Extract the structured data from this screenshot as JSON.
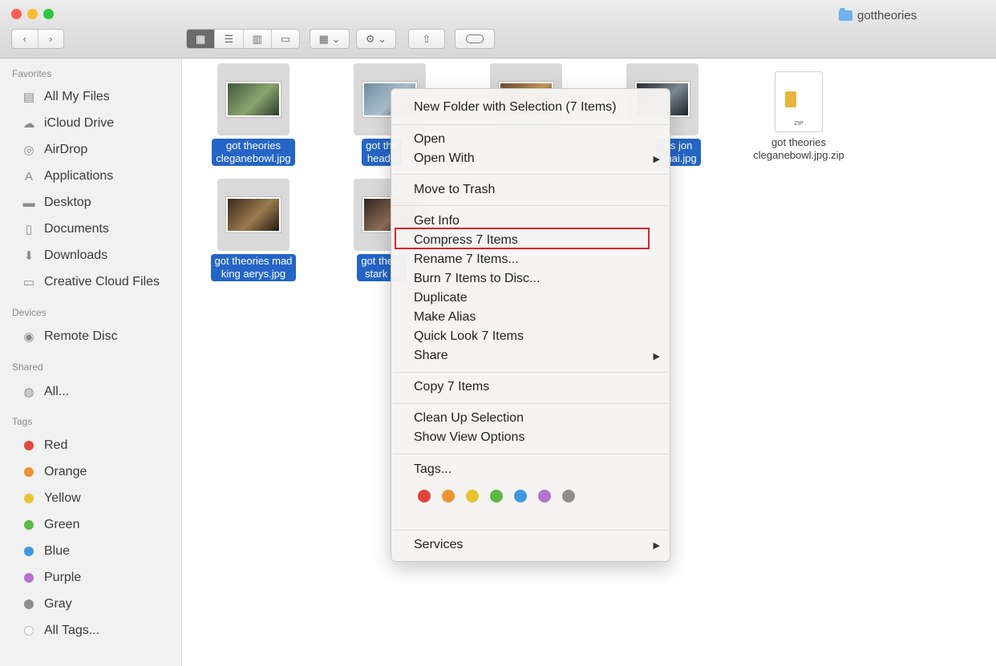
{
  "window": {
    "title": "gottheories",
    "toolbar_icons": [
      "back-icon",
      "forward-icon",
      "icon-view-icon",
      "list-view-icon",
      "column-view-icon",
      "coverflow-view-icon",
      "arrange-icon",
      "action-gear-icon",
      "share-icon",
      "tag-icon"
    ]
  },
  "sidebar": {
    "favorites_header": "Favorites",
    "favorites": [
      {
        "label": "All My Files",
        "icon": "all-files-icon"
      },
      {
        "label": "iCloud Drive",
        "icon": "cloud-icon"
      },
      {
        "label": "AirDrop",
        "icon": "airdrop-icon"
      },
      {
        "label": "Applications",
        "icon": "applications-icon"
      },
      {
        "label": "Desktop",
        "icon": "desktop-icon"
      },
      {
        "label": "Documents",
        "icon": "documents-icon"
      },
      {
        "label": "Downloads",
        "icon": "downloads-icon"
      },
      {
        "label": "Creative Cloud Files",
        "icon": "folder-icon"
      }
    ],
    "devices_header": "Devices",
    "devices": [
      {
        "label": "Remote Disc",
        "icon": "disc-icon"
      }
    ],
    "shared_header": "Shared",
    "shared": [
      {
        "label": "All...",
        "icon": "network-icon"
      }
    ],
    "tags_header": "Tags",
    "tags": [
      {
        "label": "Red",
        "color": "#e0453d"
      },
      {
        "label": "Orange",
        "color": "#ee9436"
      },
      {
        "label": "Yellow",
        "color": "#e8c232"
      },
      {
        "label": "Green",
        "color": "#5bb944"
      },
      {
        "label": "Blue",
        "color": "#3d98e0"
      },
      {
        "label": "Purple",
        "color": "#b471d0"
      },
      {
        "label": "Gray",
        "color": "#8e8e8e"
      },
      {
        "label": "All Tags...",
        "color": "#dcdcdc"
      }
    ]
  },
  "files": [
    {
      "line1": "got theories",
      "line2": "cleganebowl.jpg",
      "selected": true
    },
    {
      "line1": "got the",
      "line2": "heade",
      "selected": true
    },
    {
      "line1": "",
      "line2": "",
      "selected": true
    },
    {
      "line1": "es jon",
      "line2": "ahai.jpg",
      "selected": true
    },
    {
      "line1": "got theories",
      "line2": "cleganebowl.jpg.zip",
      "selected": false
    },
    {
      "line1": "got theories mad",
      "line2": "king aerys.jpg",
      "selected": true
    },
    {
      "line1": "got theor",
      "line2": "stark st",
      "selected": true
    }
  ],
  "zip_label": "ZIP",
  "context_menu": {
    "new_folder": "New Folder with Selection (7 Items)",
    "open": "Open",
    "open_with": "Open With",
    "move_to_trash": "Move to Trash",
    "get_info": "Get Info",
    "compress": "Compress 7 Items",
    "rename": "Rename 7 Items...",
    "burn": "Burn 7 Items to Disc...",
    "duplicate": "Duplicate",
    "make_alias": "Make Alias",
    "quick_look": "Quick Look 7 Items",
    "share": "Share",
    "copy": "Copy 7 Items",
    "clean_up": "Clean Up Selection",
    "show_view_options": "Show View Options",
    "tags": "Tags...",
    "tag_colors": [
      "#e0453d",
      "#ee9436",
      "#e8c232",
      "#5bb944",
      "#3d98e0",
      "#b471d0",
      "#8e8e8e"
    ],
    "services": "Services",
    "submenu_arrow": "▶",
    "highlighted_item": "Compress 7 Items"
  }
}
